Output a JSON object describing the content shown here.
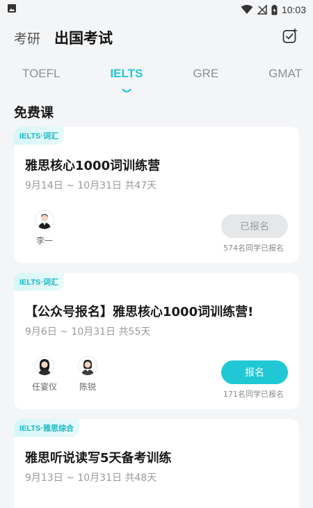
{
  "status_bar": {
    "time": "10:03"
  },
  "header": {
    "tabs": [
      {
        "label": "考研"
      },
      {
        "label": "出国考试"
      }
    ],
    "active_index": 1
  },
  "exam_tabs": [
    {
      "label": "TOEFL",
      "active": false
    },
    {
      "label": "IELTS",
      "active": true
    },
    {
      "label": "GRE",
      "active": false
    },
    {
      "label": "GMAT",
      "active": false
    }
  ],
  "section": {
    "title": "免费课"
  },
  "courses": [
    {
      "tag": "IELTS·词汇",
      "title": "雅思核心1000词训练营",
      "date_range": "9月14日 ~ 10月31日",
      "duration": "共47天",
      "teachers": [
        {
          "name": "李一"
        }
      ],
      "button_label": "已报名",
      "button_enabled": false,
      "enrolled_text": "574名同学已报名"
    },
    {
      "tag": "IELTS·词汇",
      "title": "【公众号报名】雅思核心1000词训练营!",
      "date_range": "9月6日 ~ 10月31日",
      "duration": "共55天",
      "teachers": [
        {
          "name": "任宴仪"
        },
        {
          "name": "陈锐"
        }
      ],
      "button_label": "报名",
      "button_enabled": true,
      "enrolled_text": "171名同学已报名"
    },
    {
      "tag": "IELTS·雅思综合",
      "title": "雅思听说读写5天备考训练",
      "date_range": "9月13日 ~ 10月31日",
      "duration": "共48天"
    }
  ],
  "colors": {
    "accent": "#1fc8d4",
    "background": "#f4f5f7",
    "tag_text": "#17b8c6"
  },
  "icons": [
    "image-icon",
    "wifi-icon",
    "no-signal-icon",
    "battery-icon",
    "checkin-icon"
  ]
}
